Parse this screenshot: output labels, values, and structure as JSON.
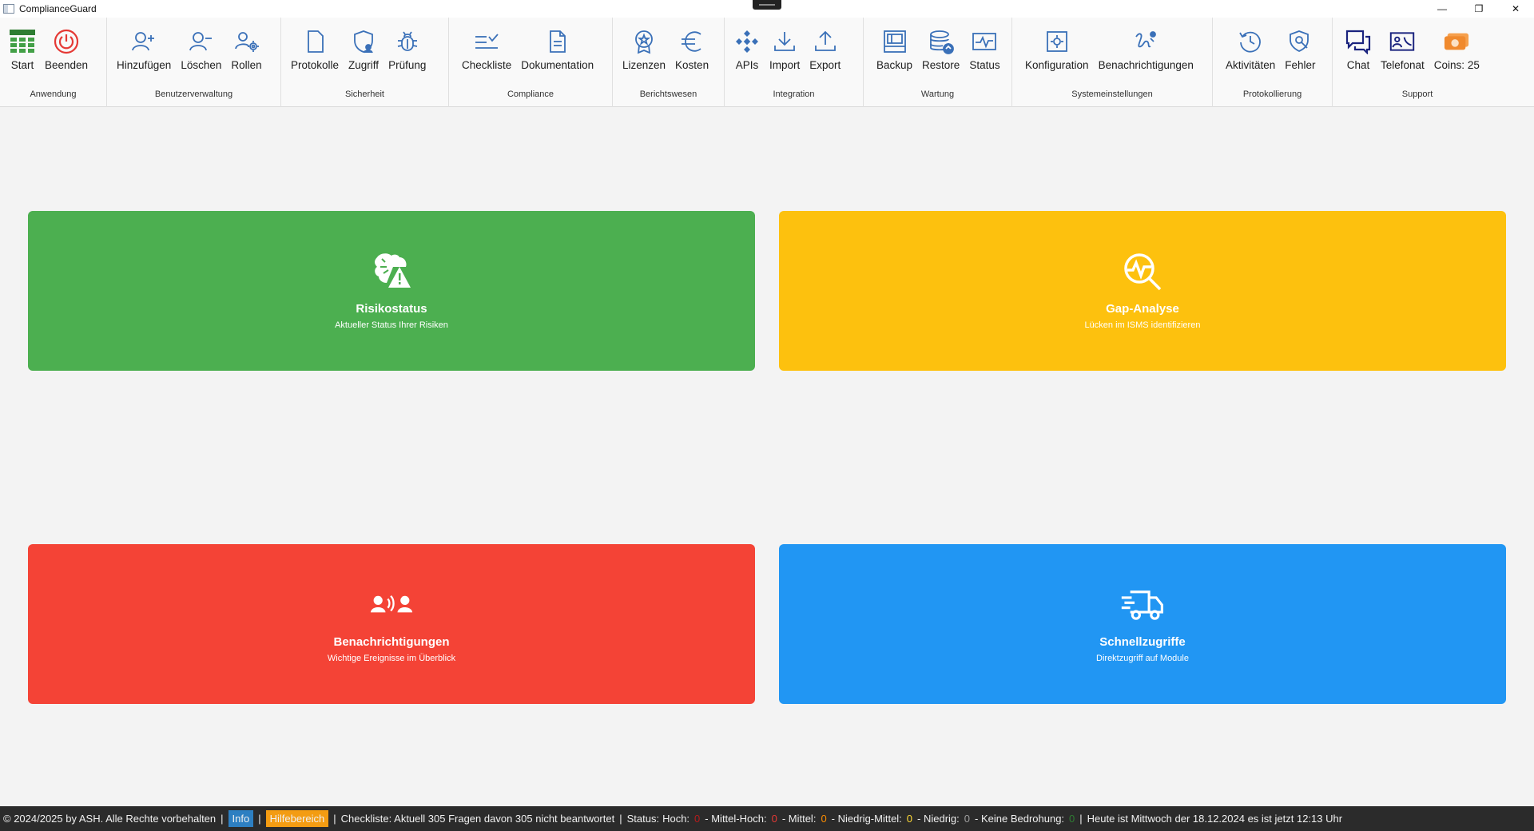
{
  "window": {
    "title": "ComplianceGuard",
    "minimize": "—",
    "restore": "❐",
    "close": "✕"
  },
  "ribbon": {
    "groups": [
      {
        "label": "Anwendung",
        "items": [
          {
            "label": "Start",
            "icon": "grid-icon"
          },
          {
            "label": "Beenden",
            "icon": "power-icon"
          }
        ]
      },
      {
        "label": "Benutzerverwaltung",
        "items": [
          {
            "label": "Hinzufügen",
            "icon": "user-add-icon"
          },
          {
            "label": "Löschen",
            "icon": "user-remove-icon"
          },
          {
            "label": "Rollen",
            "icon": "user-roles-icon"
          }
        ]
      },
      {
        "label": "Sicherheit",
        "items": [
          {
            "label": "Protokolle",
            "icon": "document-icon"
          },
          {
            "label": "Zugriff",
            "icon": "shield-user-icon"
          },
          {
            "label": "Prüfung",
            "icon": "bug-icon"
          }
        ]
      },
      {
        "label": "Compliance",
        "items": [
          {
            "label": "Checkliste",
            "icon": "checklist-icon"
          },
          {
            "label": "Dokumentation",
            "icon": "doc-lines-icon"
          }
        ]
      },
      {
        "label": "Berichtswesen",
        "items": [
          {
            "label": "Lizenzen",
            "icon": "award-icon"
          },
          {
            "label": "Kosten",
            "icon": "euro-icon"
          }
        ]
      },
      {
        "label": "Integration",
        "items": [
          {
            "label": "APIs",
            "icon": "api-icon"
          },
          {
            "label": "Import",
            "icon": "download-icon"
          },
          {
            "label": "Export",
            "icon": "upload-icon"
          }
        ]
      },
      {
        "label": "Wartung",
        "items": [
          {
            "label": "Backup",
            "icon": "backup-icon"
          },
          {
            "label": "Restore",
            "icon": "database-restore-icon"
          },
          {
            "label": "Status",
            "icon": "status-monitor-icon"
          }
        ]
      },
      {
        "label": "Systemeinstellungen",
        "items": [
          {
            "label": "Konfiguration",
            "icon": "gear-box-icon"
          },
          {
            "label": "Benachrichtigungen",
            "icon": "notification-scribble-icon"
          }
        ]
      },
      {
        "label": "Protokollierung",
        "items": [
          {
            "label": "Aktivitäten",
            "icon": "history-icon"
          },
          {
            "label": "Fehler",
            "icon": "shield-search-icon"
          }
        ]
      },
      {
        "label": "Support",
        "items": [
          {
            "label": "Chat",
            "icon": "chat-icon"
          },
          {
            "label": "Telefonat",
            "icon": "video-call-icon"
          },
          {
            "label": "Coins: 25",
            "icon": "coins-icon"
          }
        ]
      }
    ]
  },
  "cards": {
    "risk": {
      "title": "Risikostatus",
      "subtitle": "Aktueller Status Ihrer Risiken",
      "color": "#4caf50",
      "icon": "brain-warning-icon"
    },
    "gap": {
      "title": "Gap-Analyse",
      "subtitle": "Lücken im ISMS identifizieren",
      "color": "#fdc10e",
      "icon": "pulse-search-icon"
    },
    "notify": {
      "title": "Benachrichtigungen",
      "subtitle": "Wichtige Ereignisse im Überblick",
      "color": "#f44336",
      "icon": "people-talk-icon"
    },
    "quick": {
      "title": "Schnellzugriffe",
      "subtitle": "Direktzugriff auf Module",
      "color": "#2196f3",
      "icon": "fast-truck-icon"
    }
  },
  "statusbar": {
    "copyright": "© 2024/2025 by ASH. Alle Rechte vorbehalten",
    "info": "Info",
    "help": "Hilfebereich",
    "checklist": "Checkliste: Aktuell 305 Fragen davon 305 nicht beantwortet",
    "status_label": "Status:",
    "high_label": "Hoch:",
    "high": "0",
    "midhigh_label": "- Mittel-Hoch:",
    "midhigh": "0",
    "mid_label": "- Mittel:",
    "mid": "0",
    "lowmid_label": "- Niedrig-Mittel:",
    "lowmid": "0",
    "low_label": "- Niedrig:",
    "low": "0",
    "none_label": "- Keine Bedrohung:",
    "none": "0",
    "datetime": "Heute ist Mittwoch der 18.12.2024 es ist jetzt 12:13 Uhr",
    "sep": "|"
  }
}
